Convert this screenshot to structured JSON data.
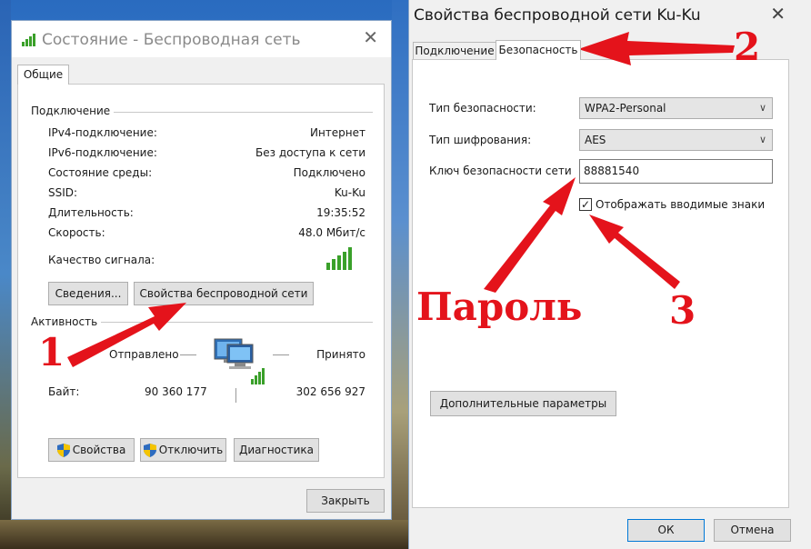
{
  "left_window": {
    "title": "Состояние - Беспроводная сеть",
    "tab": "Общие",
    "connection_group": "Подключение",
    "rows": [
      {
        "label": "IPv4-подключение:",
        "value": "Интернет"
      },
      {
        "label": "IPv6-подключение:",
        "value": "Без доступа к сети"
      },
      {
        "label": "Состояние среды:",
        "value": "Подключено"
      },
      {
        "label": "SSID:",
        "value": "Ku-Ku"
      },
      {
        "label": "Длительность:",
        "value": "19:35:52"
      },
      {
        "label": "Скорость:",
        "value": "48.0 Мбит/с"
      }
    ],
    "signal_quality_label": "Качество сигнала:",
    "details_button": "Сведения...",
    "wireless_props_button": "Свойства беспроводной сети",
    "activity_group": "Активность",
    "sent_label": "Отправлено",
    "received_label": "Принято",
    "bytes_label": "Байт:",
    "bytes_sent": "90 360 177",
    "bytes_received": "302 656 927",
    "properties_button": "Свойства",
    "disable_button": "Отключить",
    "diagnostics_button": "Диагностика",
    "close_button": "Закрыть"
  },
  "right_window": {
    "title": "Свойства беспроводной сети Ku-Ku",
    "tabs": [
      "Подключение",
      "Безопасность"
    ],
    "active_tab": "Безопасность",
    "security_type_label": "Тип безопасности:",
    "security_type_value": "WPA2-Personal",
    "encryption_type_label": "Тип шифрования:",
    "encryption_type_value": "AES",
    "key_label": "Ключ безопасности сети",
    "key_value": "88881540",
    "show_chars_label": "Отображать вводимые знаки",
    "show_chars_checked": true,
    "advanced_button": "Дополнительные параметры",
    "ok_button": "ОК",
    "cancel_button": "Отмена"
  },
  "annotations": {
    "step1": "1",
    "step2": "2",
    "step3": "3",
    "password": "Пароль",
    "color": "#e4131b"
  }
}
